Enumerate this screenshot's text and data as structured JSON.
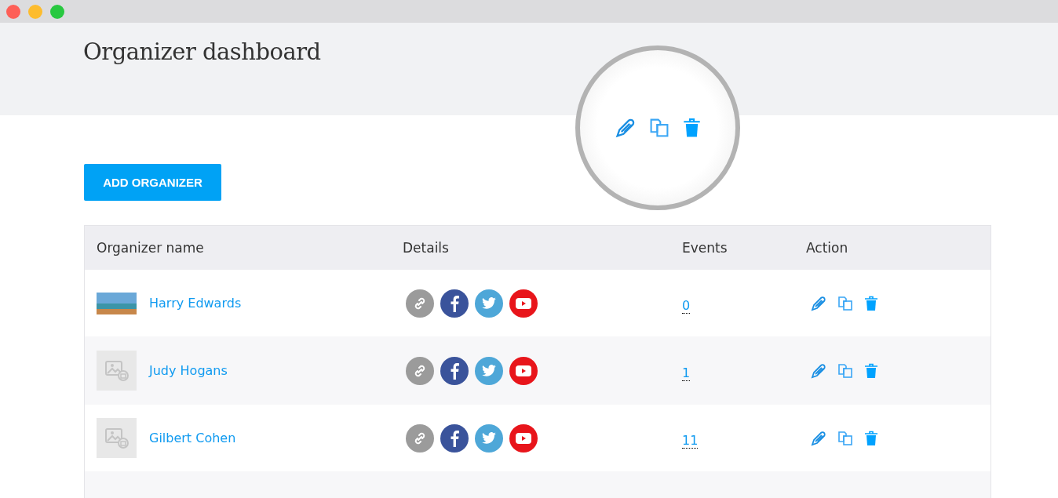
{
  "page": {
    "title": "Organizer dashboard"
  },
  "add_button": {
    "label": "ADD ORGANIZER"
  },
  "table": {
    "columns": [
      "Organizer name",
      "Details",
      "Events",
      "Action"
    ],
    "rows": [
      {
        "name": "Harry Edwards",
        "photo": true,
        "events": "0"
      },
      {
        "name": "Judy Hogans",
        "photo": false,
        "events": "1"
      },
      {
        "name": "Gilbert Cohen",
        "photo": false,
        "events": "11"
      }
    ]
  },
  "magnifier": {
    "shown": true
  }
}
